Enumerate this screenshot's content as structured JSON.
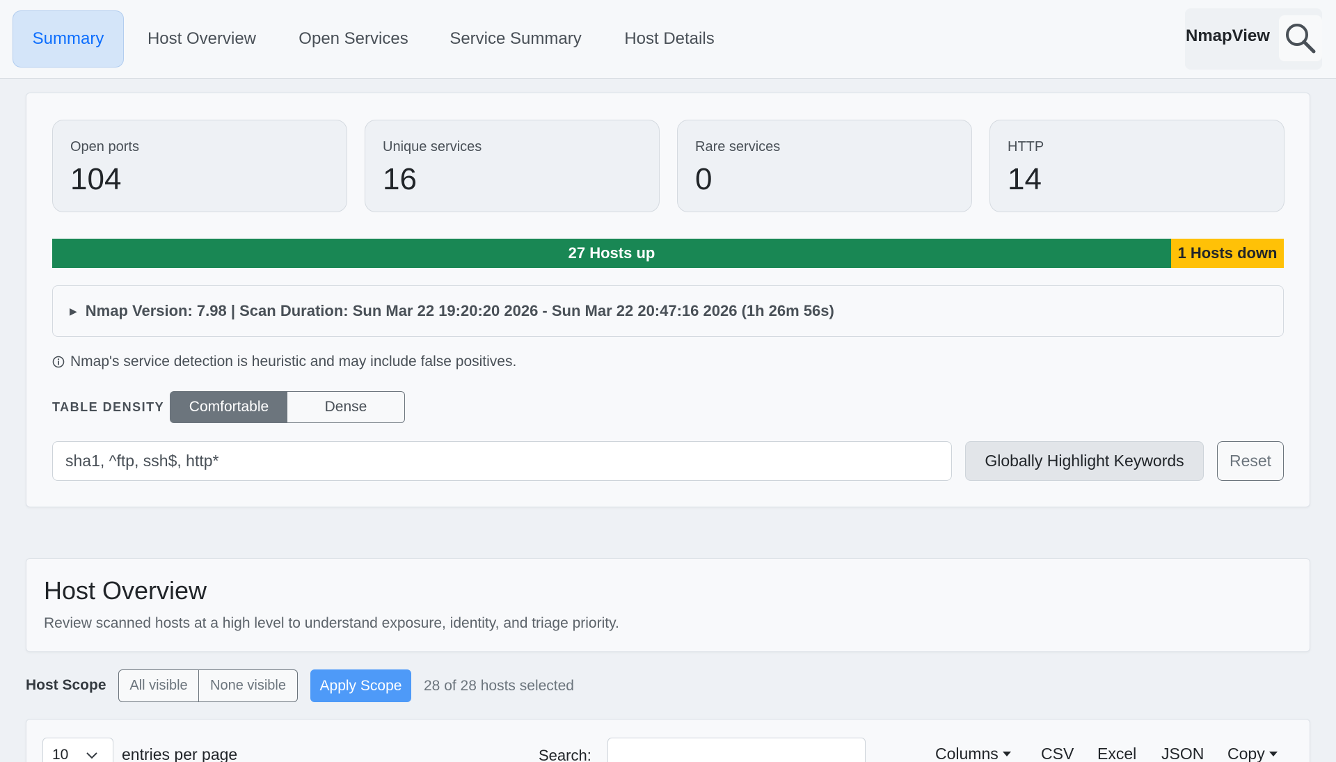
{
  "nav": {
    "tabs": [
      {
        "label": "Summary",
        "active": true
      },
      {
        "label": "Host Overview"
      },
      {
        "label": "Open Services"
      },
      {
        "label": "Service Summary"
      },
      {
        "label": "Host Details"
      }
    ],
    "brand": "NmapView",
    "search_icon": "search-icon"
  },
  "summary": {
    "stats": [
      {
        "label": "Open ports",
        "value": "104"
      },
      {
        "label": "Unique services",
        "value": "16"
      },
      {
        "label": "Rare services",
        "value": "0"
      },
      {
        "label": "HTTP",
        "value": "14"
      }
    ],
    "hosts": {
      "up_label": "27 Hosts up",
      "down_label": "1 Hosts down",
      "up": 27,
      "down": 1,
      "up_color": "#198754",
      "down_color": "#ffc107"
    },
    "scan_details": "Nmap Version: 7.98 | Scan Duration: Sun Mar 22 19:20:20 2026 - Sun Mar 22 20:47:16 2026 (1h 26m 56s)",
    "note": "Nmap's service detection is heuristic and may include false positives.",
    "density": {
      "label": "TABLE DENSITY",
      "options": [
        "Comfortable",
        "Dense"
      ],
      "selected": "Comfortable"
    },
    "keywords": {
      "value": "sha1, ^ftp, ssh$, http*",
      "highlight_label": "Globally Highlight Keywords",
      "reset_label": "Reset"
    }
  },
  "host_overview": {
    "title": "Host Overview",
    "subtitle": "Review scanned hosts at a high level to understand exposure, identity, and triage priority.",
    "scope": {
      "label": "Host Scope",
      "all_visible": "All visible",
      "none_visible": "None visible",
      "apply": "Apply Scope",
      "count": "28 of 28 hosts selected"
    },
    "table": {
      "page_size": "10",
      "entries_label": "entries per page",
      "search_label": "Search:",
      "search_value": "",
      "tools": [
        "Columns",
        "CSV",
        "Excel",
        "JSON",
        "Copy"
      ]
    }
  },
  "colors": {
    "accent": "#0d6efd",
    "apply_button": "#4e9af8",
    "density_selected": "#6c757d"
  }
}
